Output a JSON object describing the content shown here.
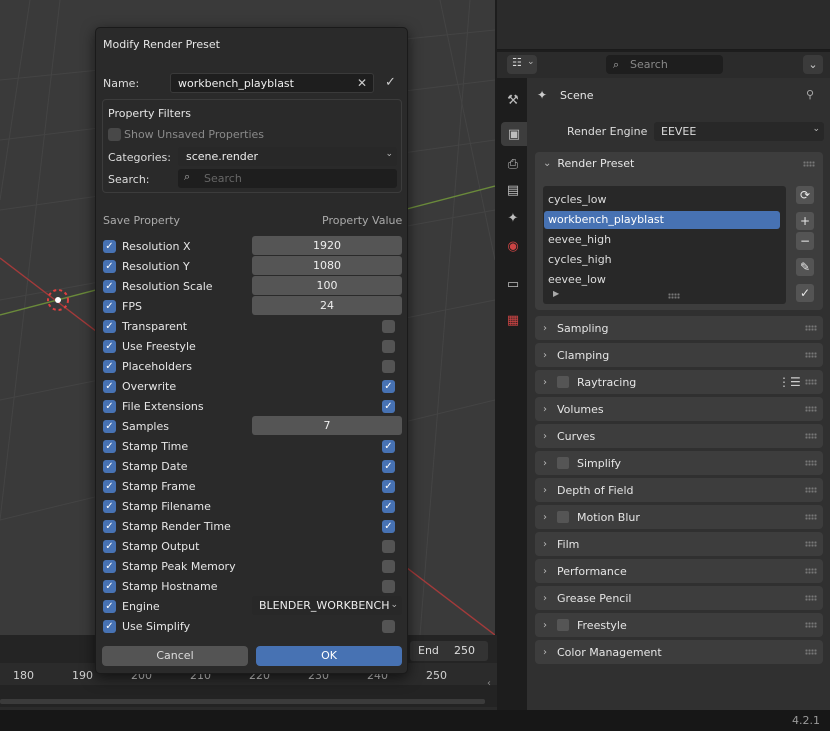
{
  "dialog": {
    "title": "Modify Render Preset",
    "name_label": "Name:",
    "name_value": "workbench_playblast",
    "filters_title": "Property Filters",
    "show_unsaved": "Show Unsaved Properties",
    "categories_label": "Categories:",
    "categories_value": "scene.render",
    "search_label": "Search:",
    "search_placeholder": "Search",
    "col_save": "Save Property",
    "col_value": "Property Value",
    "cancel": "Cancel",
    "ok": "OK",
    "rows": [
      {
        "label": "Resolution X",
        "value": "1920",
        "kind": "num"
      },
      {
        "label": "Resolution Y",
        "value": "1080",
        "kind": "num"
      },
      {
        "label": "Resolution Scale",
        "value": "100",
        "kind": "num"
      },
      {
        "label": "FPS",
        "value": "24",
        "kind": "num"
      },
      {
        "label": "Transparent",
        "checked": false,
        "kind": "bool"
      },
      {
        "label": "Use Freestyle",
        "checked": false,
        "kind": "bool"
      },
      {
        "label": "Placeholders",
        "checked": false,
        "kind": "bool"
      },
      {
        "label": "Overwrite",
        "checked": true,
        "kind": "bool"
      },
      {
        "label": "File Extensions",
        "checked": true,
        "kind": "bool"
      },
      {
        "label": "Samples",
        "value": "7",
        "kind": "num"
      },
      {
        "label": "Stamp Time",
        "checked": true,
        "kind": "bool"
      },
      {
        "label": "Stamp Date",
        "checked": true,
        "kind": "bool"
      },
      {
        "label": "Stamp Frame",
        "checked": true,
        "kind": "bool"
      },
      {
        "label": "Stamp Filename",
        "checked": true,
        "kind": "bool"
      },
      {
        "label": "Stamp Render Time",
        "checked": true,
        "kind": "bool"
      },
      {
        "label": "Stamp Output",
        "checked": false,
        "kind": "bool"
      },
      {
        "label": "Stamp Peak Memory",
        "checked": false,
        "kind": "bool"
      },
      {
        "label": "Stamp Hostname",
        "checked": false,
        "kind": "bool"
      },
      {
        "label": "Engine",
        "value": "BLENDER_WORKBENCH",
        "kind": "enum"
      },
      {
        "label": "Use Simplify",
        "checked": false,
        "kind": "bool"
      }
    ]
  },
  "properties": {
    "search_placeholder": "Search",
    "scene_label": "Scene",
    "render_engine_label": "Render Engine",
    "render_engine_value": "EEVEE",
    "preset_section": "Render Preset",
    "presets": [
      "cycles_low",
      "workbench_playblast",
      "eevee_high",
      "cycles_high",
      "eevee_low"
    ],
    "selected_preset": "workbench_playblast",
    "sections": [
      {
        "label": "Sampling",
        "checkbox": false
      },
      {
        "label": "Clamping",
        "checkbox": false
      },
      {
        "label": "Raytracing",
        "checkbox": true
      },
      {
        "label": "Volumes",
        "checkbox": false
      },
      {
        "label": "Curves",
        "checkbox": false
      },
      {
        "label": "Simplify",
        "checkbox": true
      },
      {
        "label": "Depth of Field",
        "checkbox": false
      },
      {
        "label": "Motion Blur",
        "checkbox": true
      },
      {
        "label": "Film",
        "checkbox": false
      },
      {
        "label": "Performance",
        "checkbox": false
      },
      {
        "label": "Grease Pencil",
        "checkbox": false
      },
      {
        "label": "Freestyle",
        "checkbox": true
      },
      {
        "label": "Color Management",
        "checkbox": false
      }
    ]
  },
  "timeline": {
    "end_label": "End",
    "end_value": "250",
    "ticks": [
      "180",
      "190",
      "200",
      "210",
      "220",
      "230",
      "240",
      "250"
    ]
  },
  "status": {
    "version": "4.2.1"
  },
  "colors": {
    "accent": "#4772b3",
    "grid_green": "#6a8a3a",
    "grid_red": "#a33a3a"
  }
}
